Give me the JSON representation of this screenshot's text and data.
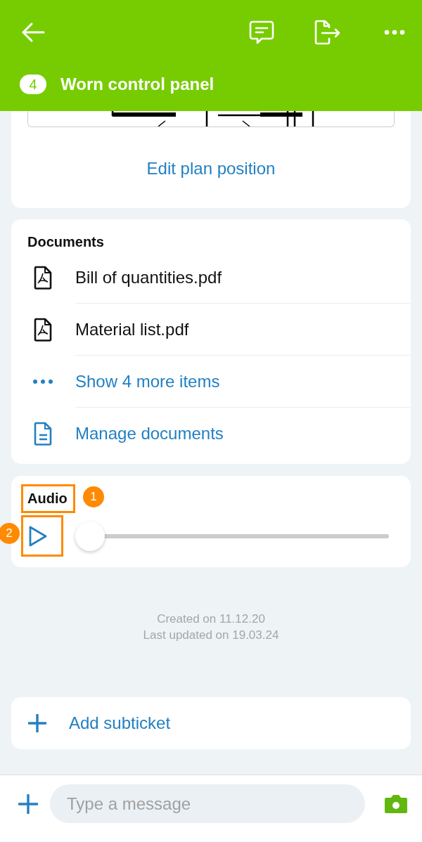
{
  "header": {
    "badge": "4",
    "title": "Worn control panel"
  },
  "plan": {
    "link": "Edit plan position"
  },
  "documents": {
    "title": "Documents",
    "items": [
      {
        "kind": "file",
        "label": "Bill of quantities.pdf"
      },
      {
        "kind": "file",
        "label": "Material list.pdf"
      },
      {
        "kind": "more",
        "label": "Show 4 more items"
      },
      {
        "kind": "manage",
        "label": "Manage documents"
      }
    ]
  },
  "audio": {
    "title": "Audio",
    "level": 0
  },
  "annotations": [
    {
      "label": "1"
    },
    {
      "label": "2"
    }
  ],
  "meta": {
    "created": "Created on 11.12.20",
    "updated": "Last updated on 19.03.24"
  },
  "subticket": {
    "label": "Add subticket"
  },
  "composer": {
    "placeholder": "Type a message"
  }
}
